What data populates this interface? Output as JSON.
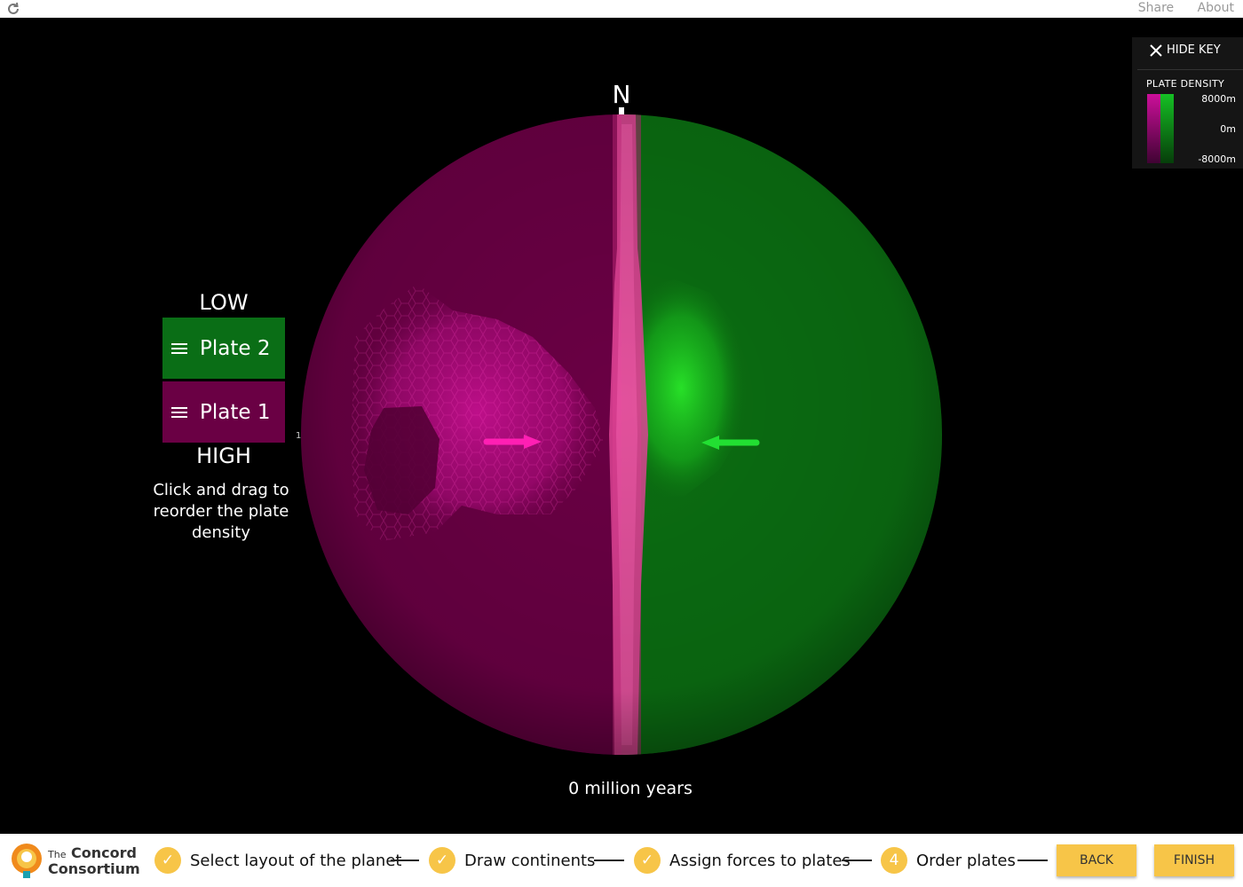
{
  "topbar": {
    "share_label": "Share",
    "about_label": "About"
  },
  "key": {
    "hide_label": "HIDE KEY",
    "title": "PLATE DENSITY",
    "top_label": "8000m",
    "mid_label": "0m",
    "bottom_label": "-8000m",
    "colors": {
      "plate1": "#cc0f9a",
      "plate2": "#15c024"
    }
  },
  "plate_panel": {
    "low_label": "LOW",
    "high_label": "HIGH",
    "plates": [
      {
        "label": "Plate 2",
        "color": "#0a6e16"
      },
      {
        "label": "Plate 1",
        "color": "#6a0044"
      }
    ],
    "hint": "Click and drag to reorder the plate density",
    "side_tick": "1"
  },
  "globe": {
    "north_label": "N",
    "time_label": "0 million years"
  },
  "footer": {
    "logo_small": "The",
    "logo_line1": "Concord",
    "logo_line2": "Consortium",
    "steps": [
      {
        "label": "Select layout of the planet",
        "status": "done"
      },
      {
        "label": "Draw continents",
        "status": "done"
      },
      {
        "label": "Assign forces to plates",
        "status": "done"
      },
      {
        "label": "Order plates",
        "status": "current",
        "number": "4"
      }
    ],
    "back_label": "BACK",
    "finish_label": "FINISH"
  }
}
